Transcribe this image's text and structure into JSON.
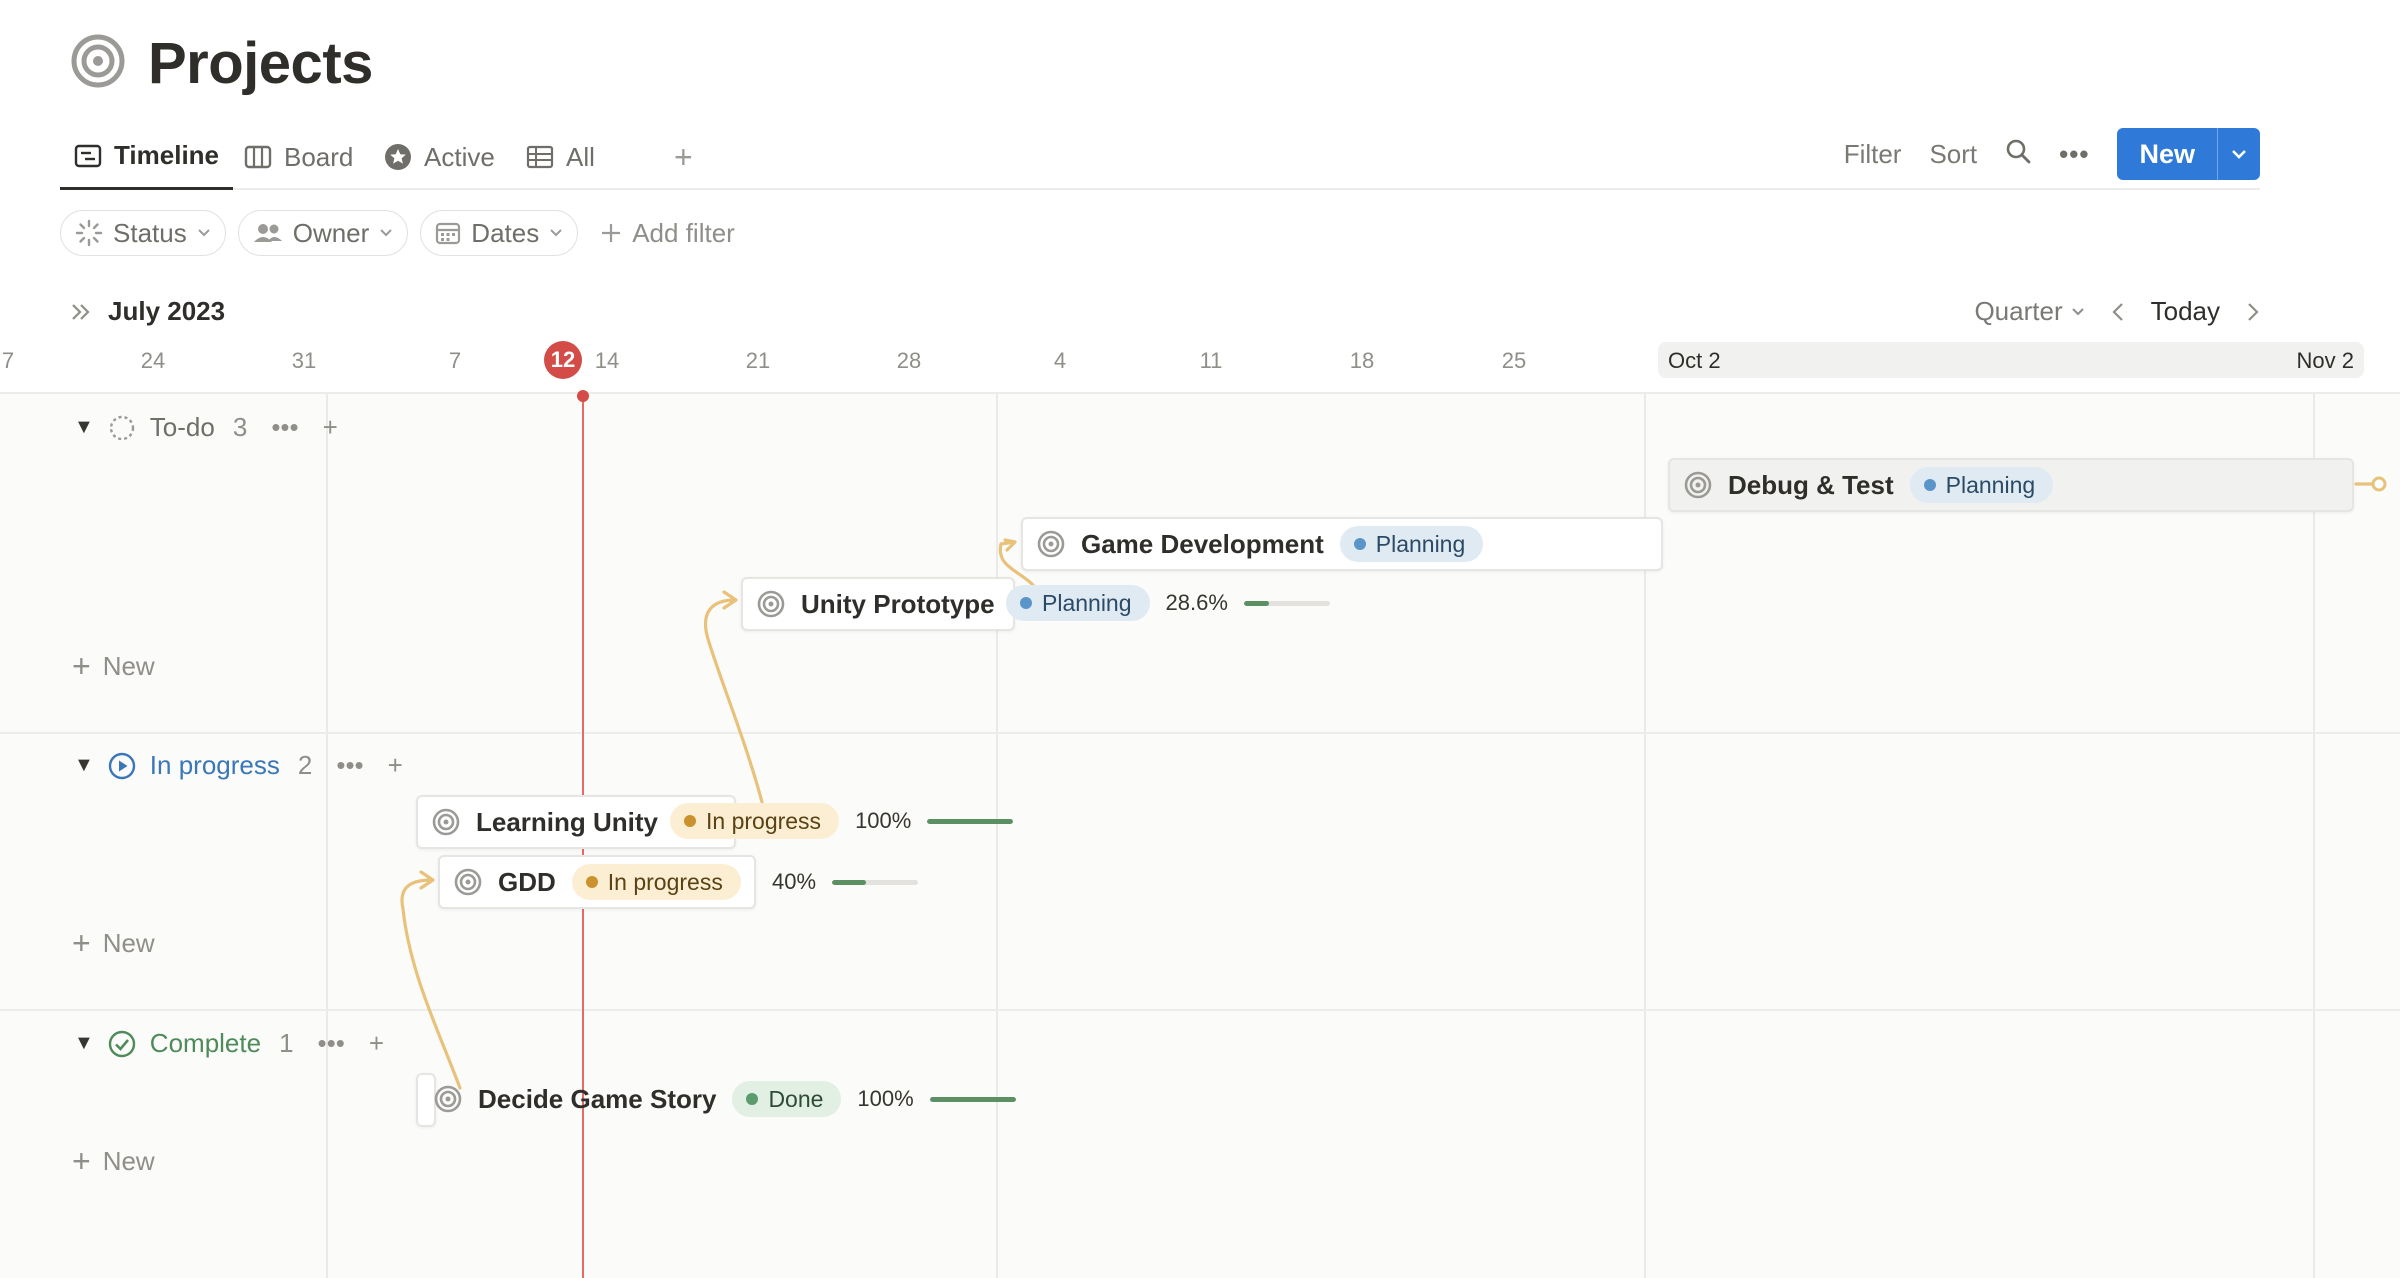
{
  "page": {
    "title": "Projects",
    "icon": "target-icon"
  },
  "views": {
    "tabs": [
      {
        "label": "Timeline",
        "icon": "timeline-icon",
        "active": true
      },
      {
        "label": "Board",
        "icon": "board-icon",
        "active": false
      },
      {
        "label": "Active",
        "icon": "star-badge-icon",
        "active": false
      },
      {
        "label": "All",
        "icon": "table-icon",
        "active": false
      }
    ],
    "add_view": "+"
  },
  "toolbar": {
    "filter": "Filter",
    "sort": "Sort",
    "new_label": "New"
  },
  "filters": {
    "status": "Status",
    "owner": "Owner",
    "dates": "Dates",
    "add_filter": "Add filter"
  },
  "timeline": {
    "month": "July 2023",
    "scale": "Quarter",
    "today_label": "Today",
    "today_date": "12",
    "dates": [
      "7",
      "24",
      "31",
      "7",
      "14",
      "21",
      "28",
      "4",
      "11",
      "18",
      "25"
    ],
    "range_start": "Oct 2",
    "range_end": "Nov 2"
  },
  "groups": [
    {
      "name": "To-do",
      "count": "3",
      "color": "#8f8e89",
      "new_label": "New"
    },
    {
      "name": "In progress",
      "count": "2",
      "color": "#3a77b8",
      "new_label": "New"
    },
    {
      "name": "Complete",
      "count": "1",
      "color": "#4f8a5b",
      "new_label": "New"
    }
  ],
  "items": {
    "debug": {
      "name": "Debug & Test",
      "status": "Planning"
    },
    "gamedev": {
      "name": "Game Development",
      "status": "Planning"
    },
    "unity": {
      "name": "Unity Prototype",
      "status": "Planning",
      "progress": "28.6%",
      "progress_value": 0.286
    },
    "learning": {
      "name": "Learning Unity",
      "status": "In progress",
      "progress": "100%",
      "progress_value": 1.0
    },
    "gdd": {
      "name": "GDD",
      "status": "In progress",
      "progress": "40%",
      "progress_value": 0.4
    },
    "story": {
      "name": "Decide Game Story",
      "status": "Done",
      "progress": "100%",
      "progress_value": 1.0
    }
  },
  "colors": {
    "accent": "#2f7ad9",
    "today": "#d44c47",
    "dependency": "#e8c27a",
    "progress_fill": "#5c8f63"
  }
}
